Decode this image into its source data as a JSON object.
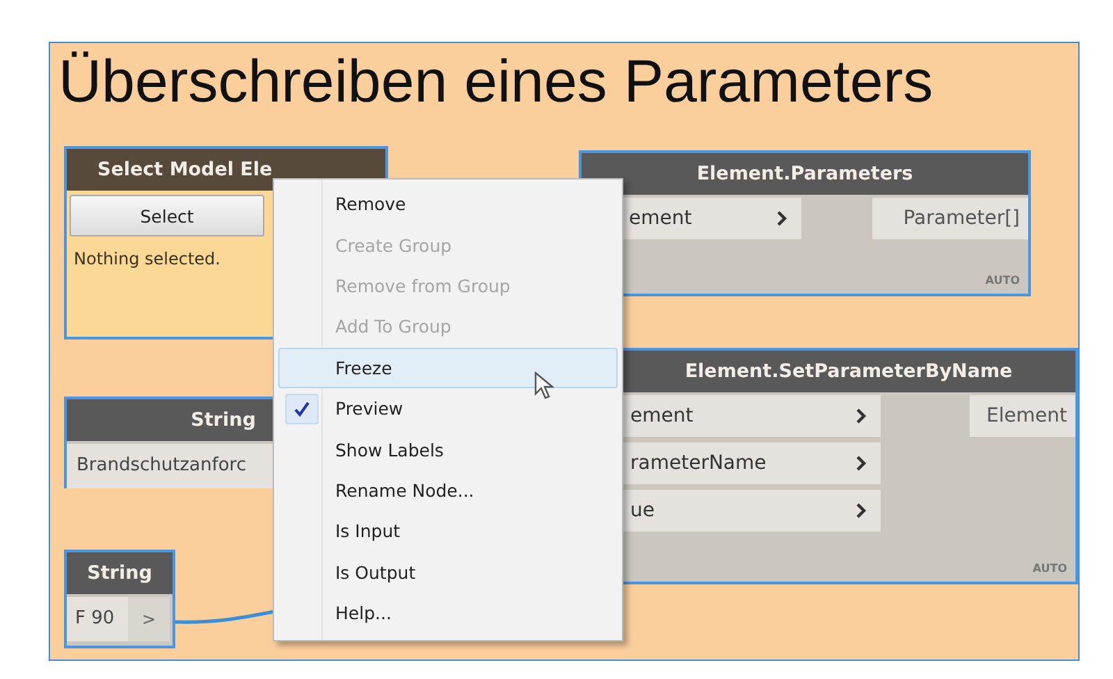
{
  "group": {
    "title": "Überschreiben eines Parameters"
  },
  "nodes": [
    {
      "kind": "selection",
      "title": "Select Model Ele",
      "button": "Select",
      "status": "Nothing selected."
    },
    {
      "kind": "function",
      "title": "Element.Parameters",
      "inputs": [
        "ement"
      ],
      "outputs": [
        "Parameter[]"
      ],
      "lacing": "AUTO"
    },
    {
      "kind": "function",
      "title": "Element.SetParameterByName",
      "inputs": [
        "ement",
        "rameterName",
        "ue"
      ],
      "outputs": [
        "Element"
      ],
      "lacing": "AUTO"
    },
    {
      "kind": "string",
      "title": "String",
      "value": "Brandschutzanforc"
    },
    {
      "kind": "string",
      "title": "String",
      "value": "F 90",
      "port": ">"
    }
  ],
  "context_menu": {
    "items": [
      {
        "label": "Remove",
        "disabled": false,
        "checked": false,
        "selected": false
      },
      {
        "label": "Create Group",
        "disabled": true,
        "checked": false,
        "selected": false
      },
      {
        "label": "Remove from Group",
        "disabled": true,
        "checked": false,
        "selected": false
      },
      {
        "label": "Add To Group",
        "disabled": true,
        "checked": false,
        "selected": false
      },
      {
        "label": "Freeze",
        "disabled": false,
        "checked": false,
        "selected": true
      },
      {
        "label": "Preview",
        "disabled": false,
        "checked": true,
        "selected": false
      },
      {
        "label": "Show Labels",
        "disabled": false,
        "checked": false,
        "selected": false
      },
      {
        "label": "Rename Node...",
        "disabled": false,
        "checked": false,
        "selected": false
      },
      {
        "label": "Is Input",
        "disabled": false,
        "checked": false,
        "selected": false
      },
      {
        "label": "Is Output",
        "disabled": false,
        "checked": false,
        "selected": false
      },
      {
        "label": "Help...",
        "disabled": false,
        "checked": false,
        "selected": false
      }
    ]
  }
}
